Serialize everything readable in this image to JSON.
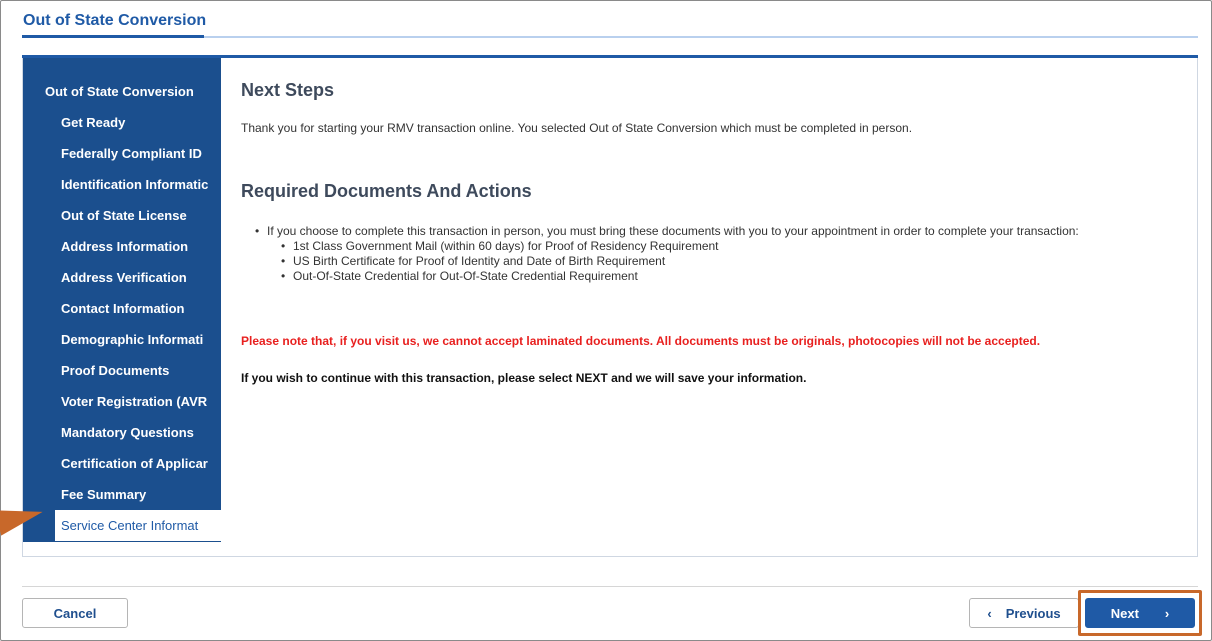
{
  "page": {
    "title": "Out of State Conversion"
  },
  "sidebar": {
    "heading": "Out of State Conversion",
    "items": [
      {
        "label": "Get Ready"
      },
      {
        "label": "Federally Compliant ID"
      },
      {
        "label": "Identification Informatic"
      },
      {
        "label": "Out of State License"
      },
      {
        "label": "Address Information"
      },
      {
        "label": "Address Verification"
      },
      {
        "label": "Contact Information"
      },
      {
        "label": "Demographic Informati"
      },
      {
        "label": "Proof Documents"
      },
      {
        "label": "Voter Registration (AVR"
      },
      {
        "label": "Mandatory Questions"
      },
      {
        "label": "Certification of Applicar"
      },
      {
        "label": "Fee Summary"
      },
      {
        "label": "Service Center Informat"
      }
    ]
  },
  "content": {
    "next_steps_heading": "Next Steps",
    "intro": "Thank you for starting your RMV transaction online. You selected Out of State Conversion which must be completed in person.",
    "required_heading": "Required Documents And Actions",
    "bring_docs": "If you choose to complete this transaction in person, you must bring these documents with you to your appointment in order to complete your transaction:",
    "documents": [
      "1st Class Government Mail (within 60 days) for Proof of Residency Requirement",
      "US Birth Certificate for Proof of Identity and Date of Birth Requirement",
      "Out-Of-State Credential for Out-Of-State Credential Requirement"
    ],
    "warning": "Please note that, if you visit us, we cannot accept laminated documents. All documents must be originals, photocopies will not be accepted.",
    "continue_note": "If you wish to continue with this transaction, please select NEXT and we will save your information."
  },
  "footer": {
    "cancel_label": "Cancel",
    "previous_label": "Previous",
    "next_label": "Next",
    "prev_icon": "‹",
    "next_icon": "›"
  },
  "colors": {
    "brand_blue": "#1f5aa6",
    "sidebar_bg": "#1b4f8e",
    "warning_red": "#e8201f",
    "annotation_orange": "#c8682a"
  }
}
